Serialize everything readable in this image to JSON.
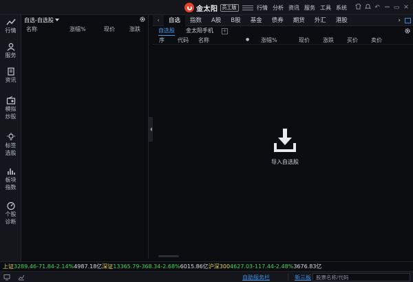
{
  "app": {
    "name": "金太阳",
    "badge": "员工版"
  },
  "top_menu": [
    "行情",
    "分析",
    "资讯",
    "服务",
    "工具",
    "系统"
  ],
  "window_controls": {
    "back": "↶",
    "restore": "▭",
    "close": "✕"
  },
  "rail": [
    {
      "label1": "行情",
      "label2": "",
      "icon": "line-chart-icon"
    },
    {
      "label1": "服务",
      "label2": "",
      "icon": "person-icon"
    },
    {
      "label1": "资讯",
      "label2": "",
      "icon": "document-icon"
    },
    {
      "label1": "模拟",
      "label2": "炒股",
      "icon": "radio-icon"
    },
    {
      "label1": "标签",
      "label2": "选股",
      "icon": "bulb-icon"
    },
    {
      "label1": "板块",
      "label2": "指数",
      "icon": "bar-chart-icon"
    },
    {
      "label1": "个股",
      "label2": "诊断",
      "icon": "gauge-icon"
    }
  ],
  "left_panel": {
    "title": "自选-自选股",
    "columns": [
      "名称",
      "涨幅%",
      "现价",
      "涨跌"
    ]
  },
  "main": {
    "tabs": [
      "自选",
      "指数",
      "A股",
      "B股",
      "基金",
      "债券",
      "期货",
      "外汇",
      "港股"
    ],
    "active_tab": "自选",
    "subtabs": [
      "自选股",
      "金太阳手机"
    ],
    "add_label": "+",
    "columns": [
      "序",
      "代码",
      "名称",
      "●",
      "涨幅%",
      "现价",
      "涨跌",
      "买价",
      "卖价"
    ],
    "empty_action": "导入自选股"
  },
  "ticker": [
    {
      "name": "上证",
      "value": "3289.46",
      "change": "-71.84",
      "pct": "-2.14%",
      "amount": "4987.18亿"
    },
    {
      "name": "深证",
      "value": "13365.79",
      "change": "-368.34",
      "pct": "-2.68%",
      "amount": "6015.86亿"
    },
    {
      "name": "沪深300",
      "value": "4627.03",
      "change": "-117.44",
      "pct": "-2.48%",
      "amount": "3676.83亿"
    }
  ],
  "status": {
    "link1": "自助服务栏",
    "link2": "新三板",
    "search_placeholder": "股票名称/代码"
  },
  "colors": {
    "accent": "#3c8de0",
    "down": "#3fd45a",
    "index_name": "#e6d45a",
    "logo": "#e8412b"
  }
}
